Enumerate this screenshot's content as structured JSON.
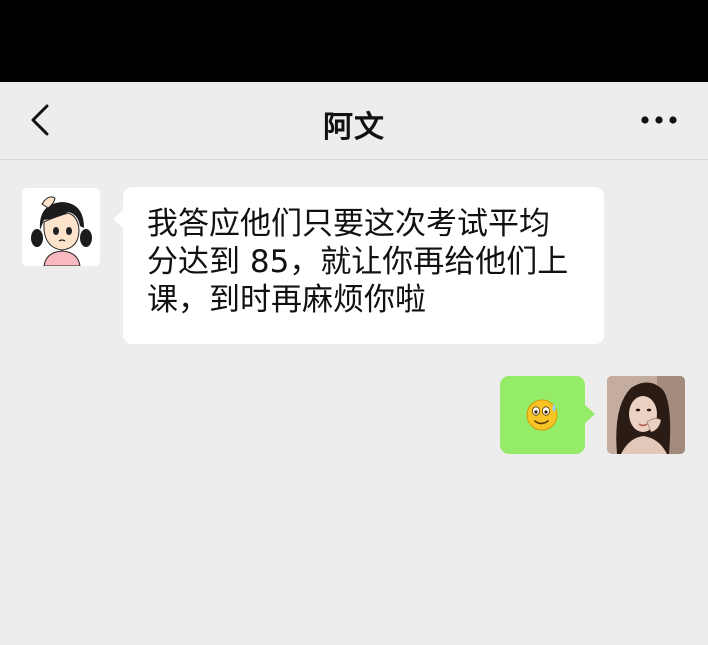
{
  "header": {
    "title": "阿文",
    "back_icon": "chevron-left-icon",
    "more_icon": "more-horizontal-icon"
  },
  "messages": [
    {
      "side": "left",
      "avatar_icon": "cartoon-girl-avatar",
      "text": "我答应他们只要这次考试平均\n分达到 85，就让你再给他们上\n课，到时再麻烦你啦"
    },
    {
      "side": "right",
      "avatar_icon": "woman-portrait-avatar",
      "emoji_icon": "sweat-smile-emoji-icon"
    }
  ],
  "colors": {
    "background": "#ededed",
    "status_bar": "#000000",
    "incoming_bubble": "#ffffff",
    "outgoing_bubble": "#95ec69"
  }
}
